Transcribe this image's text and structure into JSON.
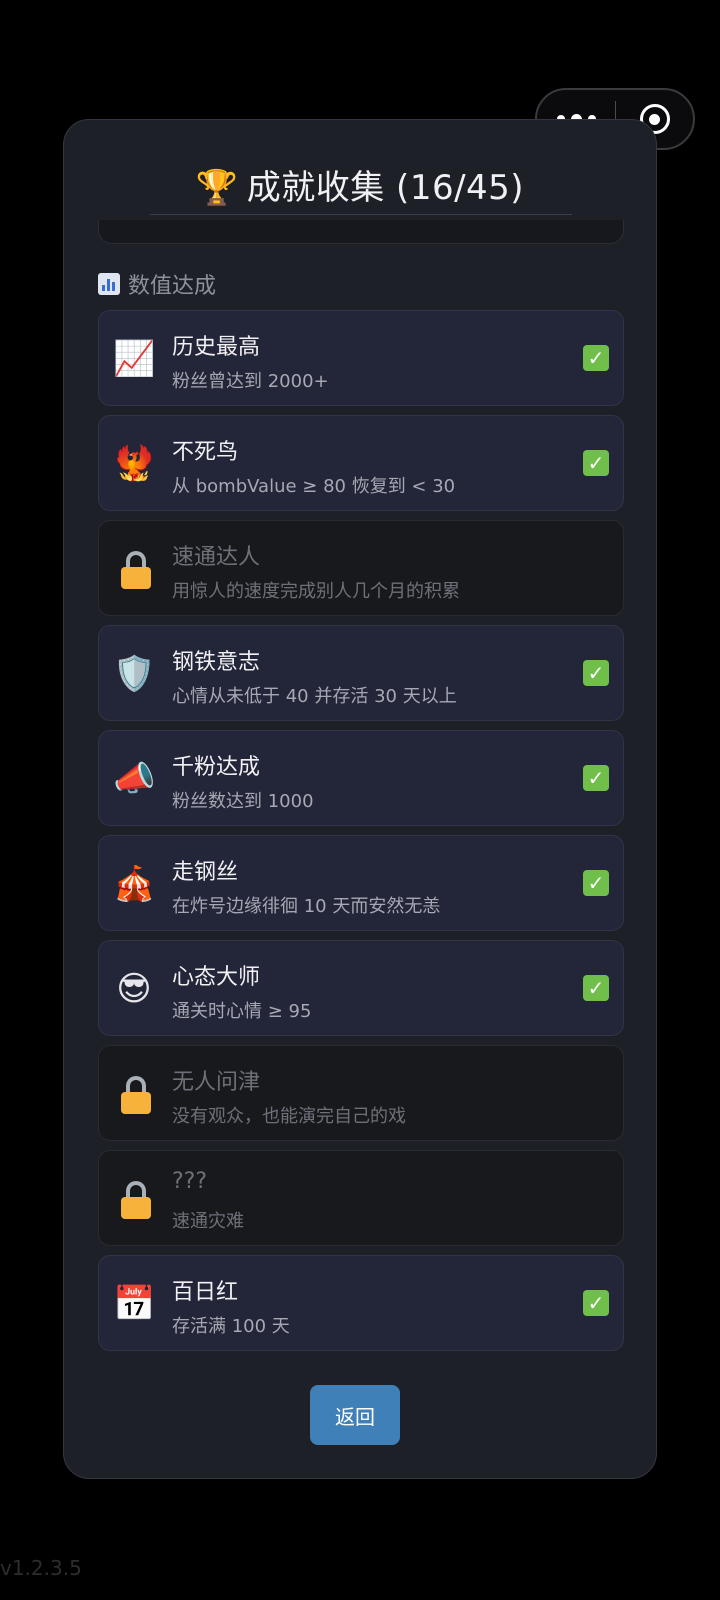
{
  "capsule": {
    "more_icon": "more-dots-icon",
    "close_icon": "target-close-icon"
  },
  "panel": {
    "title_icon": "🏆",
    "title": "成就收集 (16/45)"
  },
  "section": {
    "icon": "bar-chart-icon",
    "title": "数值达成"
  },
  "achievements": [
    {
      "icon": "📈",
      "name": "历史最高",
      "desc": "粉丝曾达到 2000+",
      "unlocked": true
    },
    {
      "icon": "🐦‍🔥",
      "name": "不死鸟",
      "desc": "从 bombValue ≥ 80 恢复到 < 30",
      "unlocked": true
    },
    {
      "icon": "lock-icon",
      "name": "速通达人",
      "desc": "用惊人的速度完成别人几个月的积累",
      "unlocked": false
    },
    {
      "icon": "🛡️",
      "name": "钢铁意志",
      "desc": "心情从未低于 40 并存活 30 天以上",
      "unlocked": true
    },
    {
      "icon": "📣",
      "name": "千粉达成",
      "desc": "粉丝数达到 1000",
      "unlocked": true
    },
    {
      "icon": "🎪",
      "name": "走钢丝",
      "desc": "在炸号边缘徘徊 10 天而安然无恙",
      "unlocked": true
    },
    {
      "icon": "😎",
      "name": "心态大师",
      "desc": "通关时心情 ≥ 95",
      "unlocked": true
    },
    {
      "icon": "lock-icon",
      "name": "无人问津",
      "desc": "没有观众，也能演完自己的戏",
      "unlocked": false
    },
    {
      "icon": "lock-icon",
      "name": "???",
      "desc": "速通灾难",
      "unlocked": false
    },
    {
      "icon": "📅",
      "name": "百日红",
      "desc": "存活满 100 天",
      "unlocked": true
    }
  ],
  "buttons": {
    "back_label": "返回"
  },
  "version": "v1.2.3.5",
  "colors": {
    "panel_bg": "#1d2027",
    "unlocked_bg": "#232538",
    "locked_bg": "#18191d",
    "check_green": "#6fbf4a",
    "button_blue": "#3f80b9"
  }
}
